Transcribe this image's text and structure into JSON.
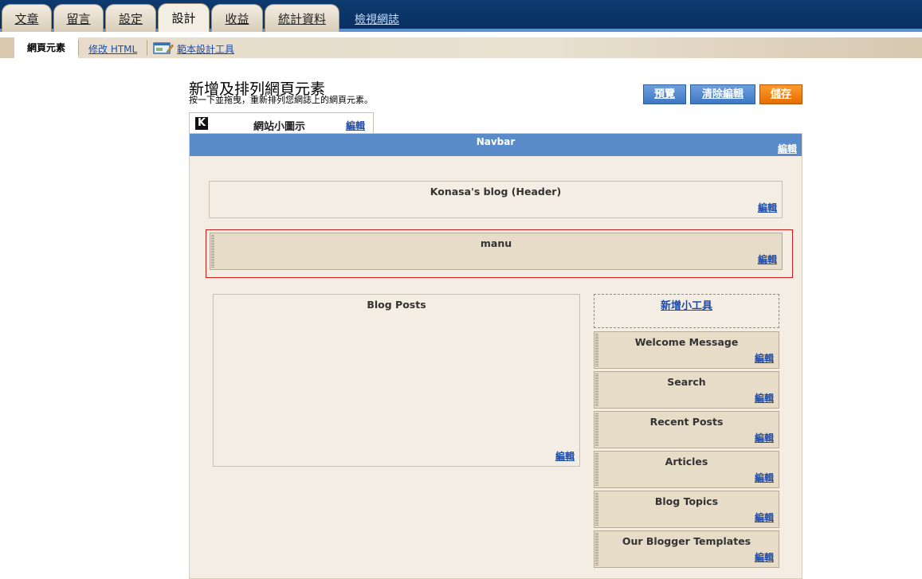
{
  "top_tabs": [
    {
      "label": "文章"
    },
    {
      "label": "留言"
    },
    {
      "label": "設定"
    },
    {
      "label": "設計"
    },
    {
      "label": "收益"
    },
    {
      "label": "統計資料"
    }
  ],
  "active_tab": "設計",
  "view_blog": "檢視網誌",
  "sub_tabs": {
    "active": "網頁元素",
    "edit_html": "修改 HTML",
    "template_designer": "範本設計工具"
  },
  "page": {
    "title": "新增及排列網頁元素",
    "subtitle": "按一下並拖曳，重新排列您網誌上的網頁元素。"
  },
  "buttons": {
    "preview": "預覽",
    "clear_edits": "清除編輯",
    "save": "儲存"
  },
  "favicon": {
    "logo_letter": "K",
    "label": "網站小圖示",
    "edit": "編輯"
  },
  "navbar": {
    "label": "Navbar",
    "edit": "編輯"
  },
  "header_widget": {
    "title": "Konasa's blog (Header)",
    "edit": "編輯"
  },
  "menu_widget": {
    "title": "manu",
    "edit": "編輯"
  },
  "blog_posts": {
    "title": "Blog Posts",
    "edit": "編輯"
  },
  "sidebar": {
    "add_gadget": "新增小工具",
    "items": [
      {
        "title": "Welcome Message",
        "edit": "編輯"
      },
      {
        "title": "Search",
        "edit": "編輯"
      },
      {
        "title": "Recent Posts",
        "edit": "編輯"
      },
      {
        "title": "Articles",
        "edit": "編輯"
      },
      {
        "title": "Blog Topics",
        "edit": "編輯"
      },
      {
        "title": "Our Blogger Templates",
        "edit": "編輯"
      }
    ]
  },
  "colors": {
    "topbar": "#0d3a70",
    "navbar": "#5b8cca",
    "button_blue": "#3f77c4",
    "button_orange": "#e66d00",
    "canvas": "#f4ede3",
    "selected_border": "#d11a1a"
  }
}
